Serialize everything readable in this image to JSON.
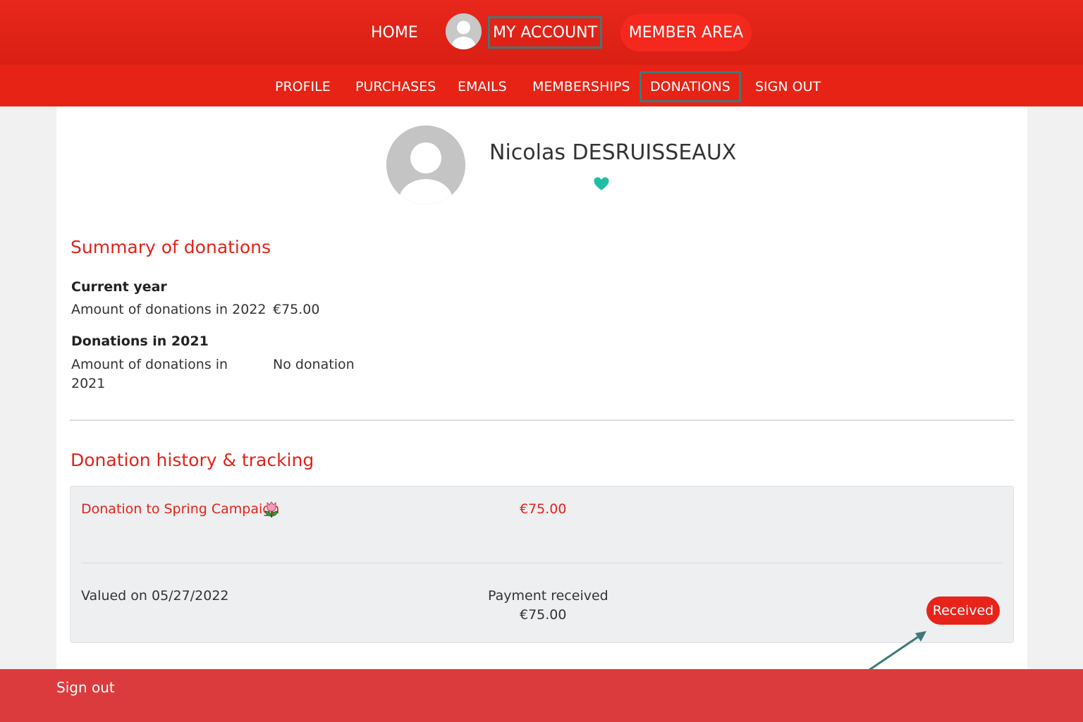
{
  "nav": {
    "home": "HOME",
    "my_account": "MY ACCOUNT",
    "member_area": "MEMBER AREA"
  },
  "subnav": {
    "items": [
      "PROFILE",
      "PURCHASES",
      "EMAILS",
      "MEMBERSHIPS",
      "DONATIONS",
      "SIGN OUT"
    ],
    "active": "DONATIONS"
  },
  "profile": {
    "name": "Nicolas DESRUISSEAUX"
  },
  "summary": {
    "title": "Summary of donations",
    "current_year_heading": "Current year",
    "current_year_label": "Amount of donations in 2022",
    "current_year_value": "€75.00",
    "prev_year_heading": "Donations in 2021",
    "prev_year_label_line1": "Amount of donations in",
    "prev_year_label_line2": "2021",
    "prev_year_value": "No donation"
  },
  "history": {
    "title": "Donation history & tracking",
    "donation_name": "Donation to Spring Campaign",
    "donation_amount": "€75.00",
    "valued_on": "Valued on 05/27/2022",
    "payment_label": "Payment received",
    "payment_amount": "€75.00",
    "status": "Received"
  },
  "footer": {
    "signout": "Sign out"
  },
  "colors": {
    "brand_red": "#e2231a",
    "highlight": "#3d7a78",
    "heart": "#1fbfa5"
  }
}
